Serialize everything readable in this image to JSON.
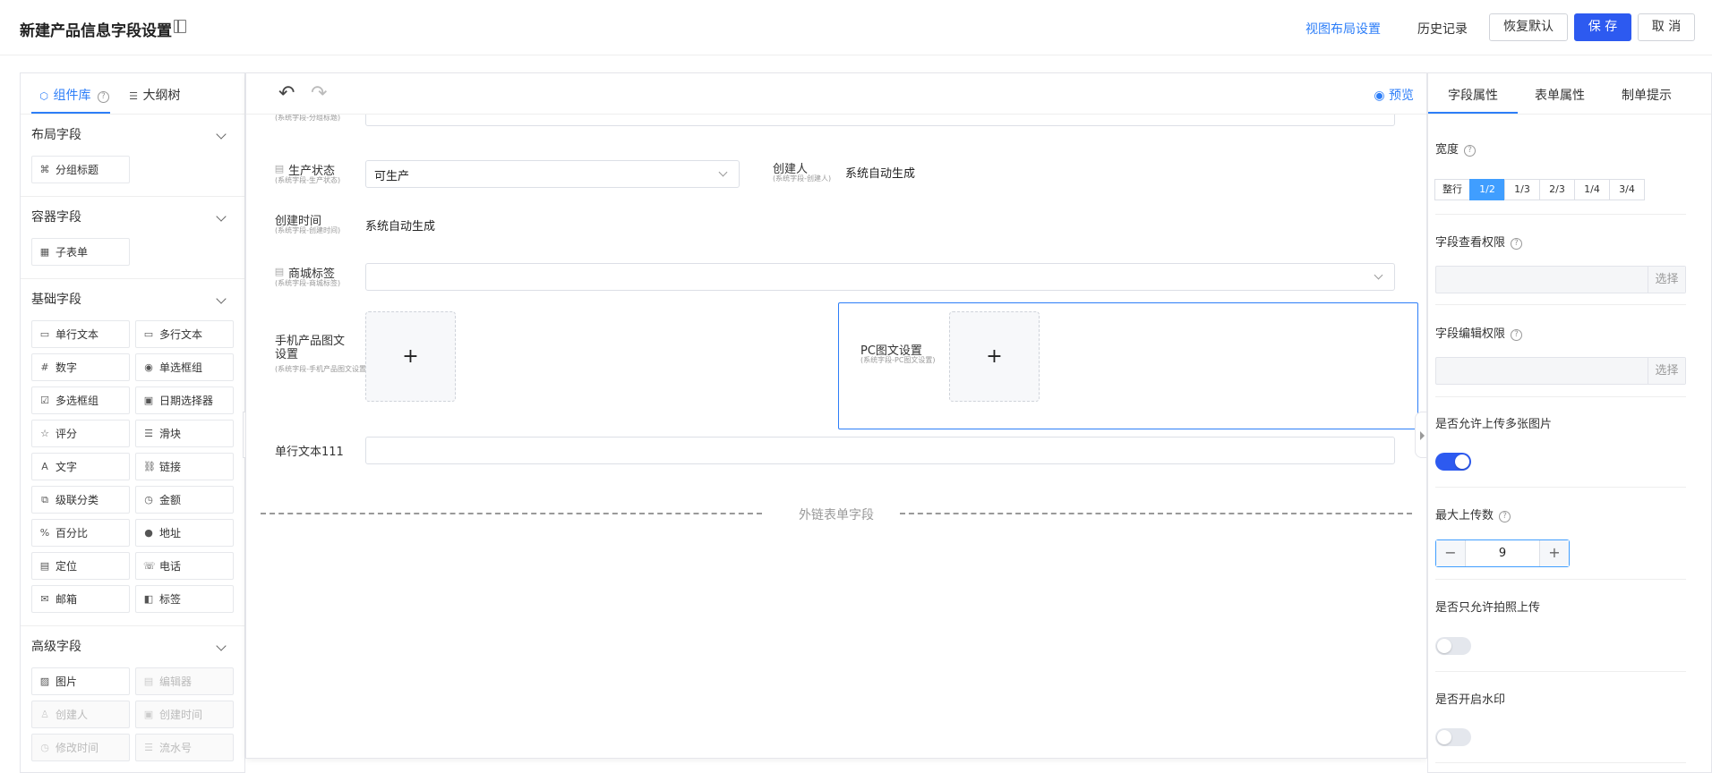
{
  "header": {
    "title": "新建产品信息字段设置",
    "view_layout": "视图布局设置",
    "history": "历史记录",
    "restore": "恢复默认",
    "save": "保 存",
    "cancel": "取 消"
  },
  "left": {
    "tabs": [
      "组件库",
      "大纲树"
    ],
    "sections": [
      {
        "title": "布局字段",
        "items": [
          {
            "label": "分组标题",
            "icon": "group-title-icon",
            "disabled": false
          }
        ]
      },
      {
        "title": "容器字段",
        "items": [
          {
            "label": "子表单",
            "icon": "table-icon",
            "disabled": false
          }
        ]
      },
      {
        "title": "基础字段",
        "items": [
          {
            "label": "单行文本",
            "icon": "single-line-icon",
            "disabled": false
          },
          {
            "label": "多行文本",
            "icon": "multi-line-icon",
            "disabled": false
          },
          {
            "label": "数字",
            "icon": "number-icon",
            "disabled": false
          },
          {
            "label": "单选框组",
            "icon": "radio-icon",
            "disabled": false
          },
          {
            "label": "多选框组",
            "icon": "checkbox-icon",
            "disabled": false
          },
          {
            "label": "日期选择器",
            "icon": "calendar-icon",
            "disabled": false
          },
          {
            "label": "评分",
            "icon": "star-icon",
            "disabled": false
          },
          {
            "label": "滑块",
            "icon": "slider-icon",
            "disabled": false
          },
          {
            "label": "文字",
            "icon": "text-icon",
            "disabled": false
          },
          {
            "label": "链接",
            "icon": "link-icon",
            "disabled": false
          },
          {
            "label": "级联分类",
            "icon": "cascade-icon",
            "disabled": false
          },
          {
            "label": "金额",
            "icon": "money-icon",
            "disabled": false
          },
          {
            "label": "百分比",
            "icon": "percent-icon",
            "disabled": false
          },
          {
            "label": "地址",
            "icon": "location-icon",
            "disabled": false
          },
          {
            "label": "定位",
            "icon": "position-icon",
            "disabled": false
          },
          {
            "label": "电话",
            "icon": "phone-icon",
            "disabled": false
          },
          {
            "label": "邮箱",
            "icon": "mail-icon",
            "disabled": false
          },
          {
            "label": "标签",
            "icon": "tag-icon",
            "disabled": false
          }
        ]
      },
      {
        "title": "高级字段",
        "items": [
          {
            "label": "图片",
            "icon": "image-icon",
            "disabled": false
          },
          {
            "label": "编辑器",
            "icon": "editor-icon",
            "disabled": true
          },
          {
            "label": "创建人",
            "icon": "user-icon",
            "disabled": true
          },
          {
            "label": "创建时间",
            "icon": "calendar-icon",
            "disabled": true
          },
          {
            "label": "修改时间",
            "icon": "clock-icon",
            "disabled": true
          },
          {
            "label": "流水号",
            "icon": "serial-icon",
            "disabled": true
          }
        ]
      }
    ]
  },
  "center": {
    "preview": "预览",
    "partial_top_sub": "(系统字段-分组标题)",
    "status": {
      "label": "生产状态",
      "sub": "(系统字段-生产状态)",
      "value": "可生产"
    },
    "creator": {
      "label": "创建人",
      "sub": "(系统字段-创建人)",
      "value": "系统自动生成"
    },
    "created_time": {
      "label": "创建时间",
      "sub": "(系统字段-创建时间)",
      "value": "系统自动生成"
    },
    "mall_tag": {
      "label": "商城标签",
      "sub": "(系统字段-商城标签)",
      "value": ""
    },
    "mobile_img": {
      "label_line1": "手机产品图文",
      "label_line2": "设置",
      "sub": "(系统字段-手机产品图文设置)"
    },
    "pc_img": {
      "label": "PC图文设置",
      "sub": "(系统字段-PC图文设置)"
    },
    "single_text": {
      "label": "单行文本111"
    },
    "divider": "外链表单字段"
  },
  "right": {
    "tabs": [
      "字段属性",
      "表单属性",
      "制单提示"
    ],
    "width_label": "宽度",
    "width_options": [
      "整行",
      "1/2",
      "1/3",
      "2/3",
      "1/4",
      "3/4"
    ],
    "width_selected": "1/2",
    "view_perm": "字段查看权限",
    "edit_perm": "字段编辑权限",
    "choose": "选择",
    "multi_upload": "是否允许上传多张图片",
    "multi_upload_on": true,
    "max_upload": "最大上传数",
    "max_upload_value": "9",
    "photo_only": "是否只允许拍照上传",
    "photo_only_on": false,
    "watermark": "是否开启水印",
    "watermark_on": false
  },
  "colors": {
    "primary": "#2d5af0",
    "link": "#2d7ef8",
    "selected_border": "#2d7ef8",
    "segment_on": "#409eff"
  }
}
